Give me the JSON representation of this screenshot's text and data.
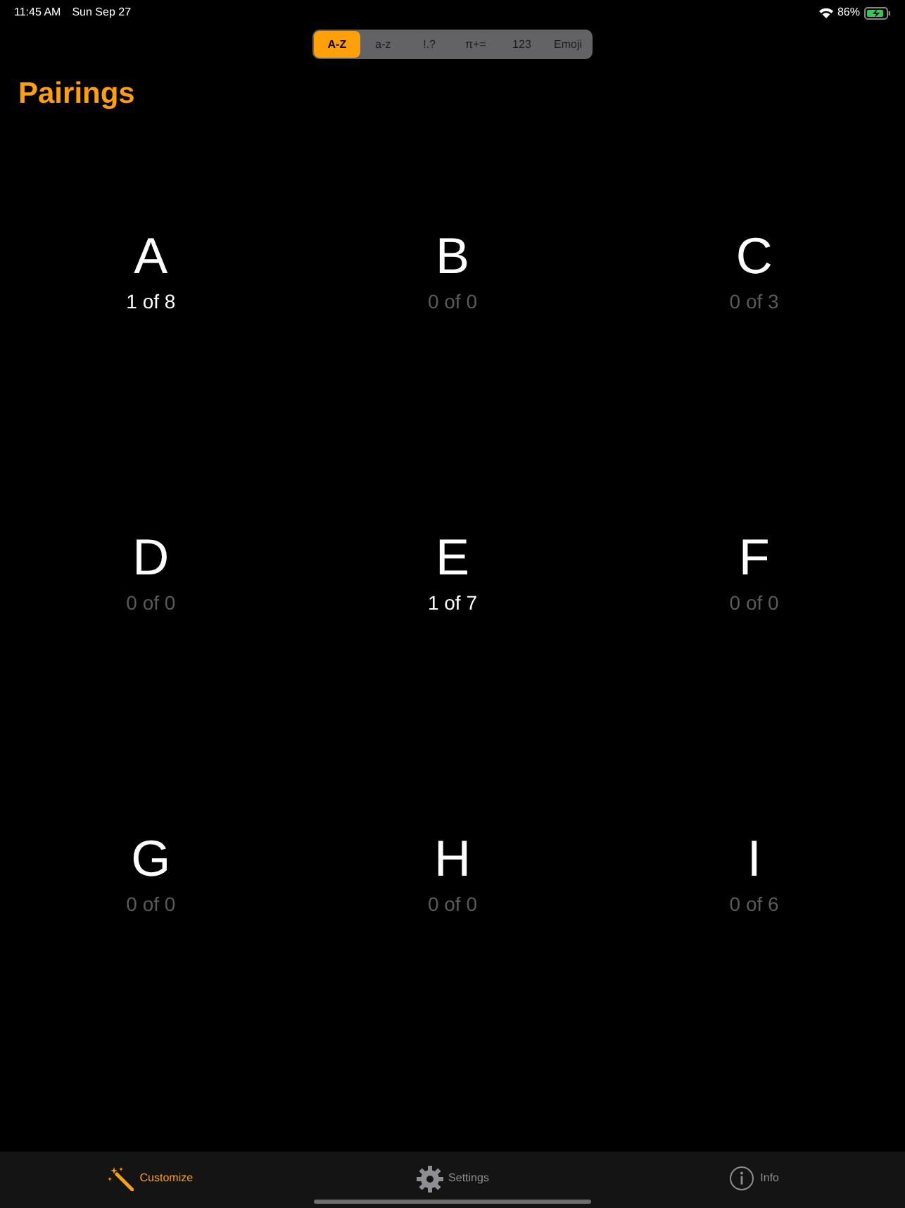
{
  "status_bar": {
    "time": "11:45 AM",
    "date": "Sun Sep 27",
    "battery": "86%"
  },
  "segments": [
    {
      "label": "A-Z",
      "selected": true
    },
    {
      "label": "a-z",
      "selected": false
    },
    {
      "label": "!.?",
      "selected": false
    },
    {
      "label": "π+=",
      "selected": false
    },
    {
      "label": "123",
      "selected": false
    },
    {
      "label": "Emoji",
      "selected": false
    }
  ],
  "title": "Pairings",
  "cells": [
    {
      "letter": "A",
      "count": "1 of 8",
      "active": true
    },
    {
      "letter": "B",
      "count": "0 of 0",
      "active": false
    },
    {
      "letter": "C",
      "count": "0 of 3",
      "active": false
    },
    {
      "letter": "D",
      "count": "0 of 0",
      "active": false
    },
    {
      "letter": "E",
      "count": "1 of 7",
      "active": true
    },
    {
      "letter": "F",
      "count": "0 of 0",
      "active": false
    },
    {
      "letter": "G",
      "count": "0 of 0",
      "active": false
    },
    {
      "letter": "H",
      "count": "0 of 0",
      "active": false
    },
    {
      "letter": "I",
      "count": "0 of 6",
      "active": false
    }
  ],
  "tab_bar": [
    {
      "kind": "wand",
      "label": "Customize",
      "selected": true
    },
    {
      "kind": "gear",
      "label": "Settings",
      "selected": false
    },
    {
      "kind": "info",
      "label": "Info",
      "selected": false
    }
  ]
}
